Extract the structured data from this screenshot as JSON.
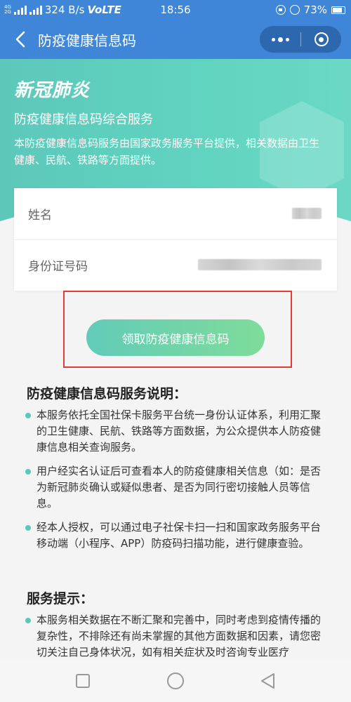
{
  "status_bar": {
    "network_labels": [
      "4G",
      "2G"
    ],
    "carrier_text": "324 B/s",
    "network_type": "VoLTE",
    "time": "18:56",
    "battery": "73%"
  },
  "navbar": {
    "title": "防疫健康信息码"
  },
  "hero": {
    "title": "新冠肺炎",
    "subtitle": "防疫健康信息码综合服务",
    "description": "本防疫健康信息码服务由国家政务服务平台提供，相关数据由卫生健康、民航、铁路等方面提供。"
  },
  "form": {
    "name_label": "姓名",
    "id_label": "身份证号码"
  },
  "action": {
    "button_label": "领取防疫健康信息码"
  },
  "service_description": {
    "title": "防疫健康信息码服务说明：",
    "items": [
      "本服务依托全国社保卡服务平台统一身份认证体系，利用汇聚的卫生健康、民航、铁路等方面数据，为公众提供本人防疫健康信息相关查询服务。",
      "用户经实名认证后可查看本人的防疫健康相关信息（如：是否为新冠肺炎确认或疑似患者、是否为同行密切接触人员等信息。",
      "经本人授权，可以通过电子社保卡扫一扫和国家政务服务平台移动端（小程序、APP）防疫码扫描功能，进行健康查验。"
    ]
  },
  "service_tips": {
    "title": "服务提示：",
    "items": [
      "本服务相关数据在不断汇聚和完善中，同时考虑到疫情传播的复杂性，不排除还有尚未掌握的其他方面数据和因素，请您密切关注自己身体状况，如有相关症状及时咨询专业医疗"
    ]
  },
  "colors": {
    "nav_blue": "#3f86d8",
    "hero_teal": "#5cc8ba",
    "button_gradient_end": "#7fdc9a",
    "highlight_red": "#e33a3a"
  },
  "icons": {
    "back": "chevron-left-icon",
    "more": "more-dots-icon",
    "close": "target-circle-icon",
    "recent": "square-icon",
    "home": "circle-icon",
    "back_nav": "triangle-left-icon"
  }
}
